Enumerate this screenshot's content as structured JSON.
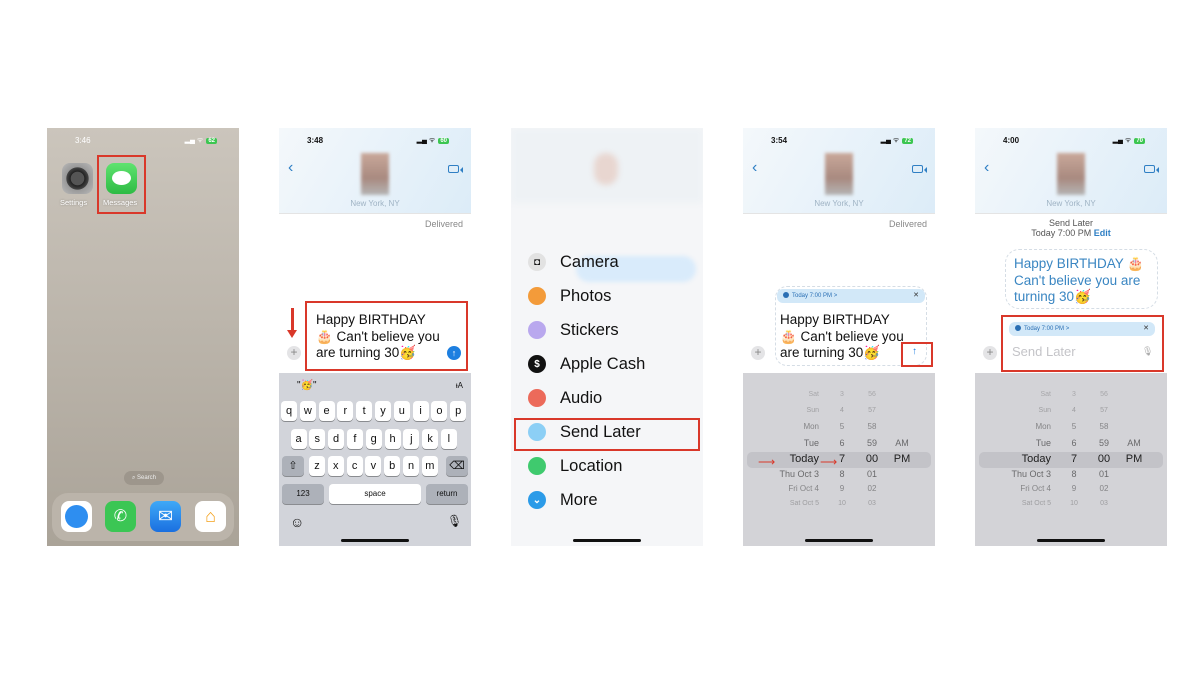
{
  "panels": [
    {
      "time": "3:46",
      "battery": "62",
      "apps": [
        {
          "label": "Settings"
        },
        {
          "label": "Messages"
        }
      ],
      "search_label": "Search",
      "dock": [
        "safari",
        "phone",
        "mail",
        "home"
      ]
    },
    {
      "time": "3:48",
      "battery": "60",
      "location": "New York, NY",
      "delivered": "Delivered",
      "message": "Happy BIRTHDAY 🎂 Can't believe you are turning 30🥳",
      "suggestion": "\"🥳\"",
      "keys_row1": [
        "q",
        "w",
        "e",
        "r",
        "t",
        "y",
        "u",
        "i",
        "o",
        "p"
      ],
      "keys_row2": [
        "a",
        "s",
        "d",
        "f",
        "g",
        "h",
        "j",
        "k",
        "l"
      ],
      "keys_row3": [
        "z",
        "x",
        "c",
        "v",
        "b",
        "n",
        "m"
      ],
      "key_123": "123",
      "key_space": "space",
      "key_return": "return"
    },
    {
      "menu": [
        {
          "label": "Camera",
          "icon": "camera-icon",
          "color": "#e2e2e2"
        },
        {
          "label": "Photos",
          "icon": "photos-icon",
          "color": "#f39b3a"
        },
        {
          "label": "Stickers",
          "icon": "stickers-icon",
          "color": "#b9a8ee"
        },
        {
          "label": "Apple Cash",
          "icon": "apple-cash-icon",
          "color": "#111111"
        },
        {
          "label": "Audio",
          "icon": "audio-icon",
          "color": "#ec6a5a"
        },
        {
          "label": "Send Later",
          "icon": "clock-icon",
          "color": "#8ccff5"
        },
        {
          "label": "Location",
          "icon": "location-icon",
          "color": "#3fca6e"
        },
        {
          "label": "More",
          "icon": "chevron-down-icon",
          "color": "#2b9be8"
        }
      ]
    },
    {
      "time": "3:54",
      "battery": "72",
      "location": "New York, NY",
      "delivered": "Delivered",
      "schedule": "Today 7:00 PM >",
      "message": "Happy BIRTHDAY 🎂 Can't believe you are turning 30🥳"
    },
    {
      "time": "4:00",
      "battery": "70",
      "location": "New York, NY",
      "send_later_title": "Send Later",
      "send_later_time": "Today 7:00 PM",
      "edit": "Edit",
      "message": "Happy BIRTHDAY 🎂 Can't believe you are turning 30🥳",
      "schedule": "Today 7:00 PM >",
      "placeholder": "Send Later"
    }
  ],
  "picker": {
    "days": [
      "Sat",
      "Sun",
      "Mon",
      "Tue",
      "Today",
      "Thu Oct 3",
      "Fri Oct 4",
      "Sat Oct 5"
    ],
    "hours": [
      "3",
      "4",
      "5",
      "6",
      "7",
      "8",
      "9",
      "10"
    ],
    "minutes": [
      "56",
      "57",
      "58",
      "59",
      "00",
      "01",
      "02",
      "03"
    ],
    "ampm": [
      "",
      "",
      "",
      "AM",
      "PM",
      "",
      "",
      ""
    ],
    "selected_index": 4
  },
  "colors": {
    "highlight": "#d9382a",
    "accent": "#2f7fc4",
    "messages_green": "#34c759"
  }
}
